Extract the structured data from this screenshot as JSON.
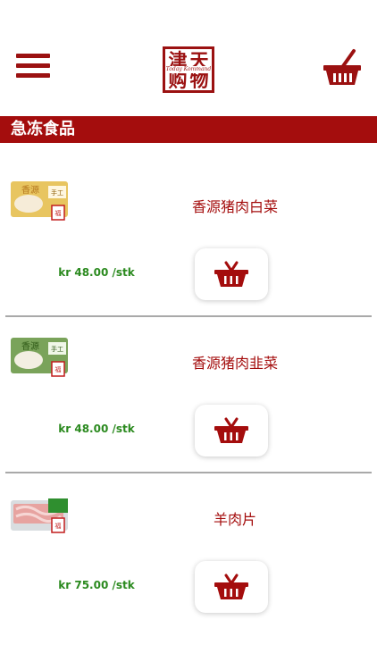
{
  "header": {
    "logo": {
      "chars": [
        "津",
        "天",
        "购",
        "物"
      ],
      "subtitle": "Today Kommand"
    }
  },
  "category": {
    "title": "急冻食品"
  },
  "products": [
    {
      "name": "香源猪肉白菜",
      "price": "kr 48.00 /stk"
    },
    {
      "name": "香源猪肉韭菜",
      "price": "kr 48.00 /stk"
    },
    {
      "name": "羊肉片",
      "price": "kr 75.00 /stk"
    }
  ],
  "icons": {
    "menu": "hamburger-icon",
    "cart": "basket-icon",
    "add": "basket-icon"
  },
  "colors": {
    "brand": "#a40d0d",
    "price": "#2b8a1f",
    "divider": "#a9a9a9"
  }
}
